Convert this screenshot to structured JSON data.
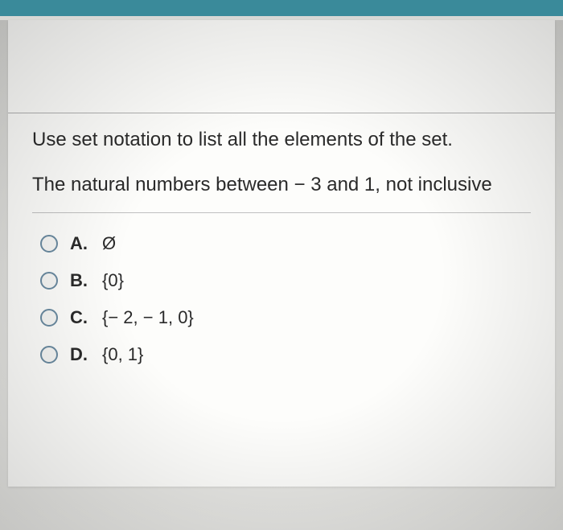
{
  "question": {
    "line1": "Use set notation to list all the elements of the set.",
    "line2": "The natural numbers between − 3 and 1, not inclusive"
  },
  "options": [
    {
      "label": "A.",
      "text": "Ø"
    },
    {
      "label": "B.",
      "text": "{0}"
    },
    {
      "label": "C.",
      "text": "{− 2, − 1, 0}"
    },
    {
      "label": "D.",
      "text": "{0, 1}"
    }
  ]
}
